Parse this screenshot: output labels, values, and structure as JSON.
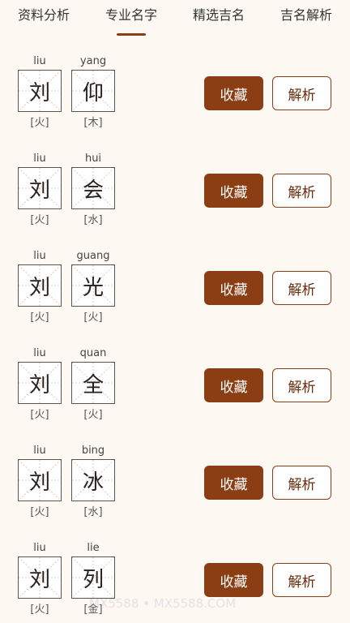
{
  "tabs": [
    {
      "label": "资料分析",
      "active": false
    },
    {
      "label": "专业名字",
      "active": true
    },
    {
      "label": "精选吉名",
      "active": false
    },
    {
      "label": "吉名解析",
      "active": false
    }
  ],
  "buttons": {
    "favorite": "收藏",
    "parse": "解析"
  },
  "names": [
    {
      "c1": {
        "pinyin": "liu",
        "char": "刘",
        "element": "[火]"
      },
      "c2": {
        "pinyin": "yang",
        "char": "仰",
        "element": "[木]"
      }
    },
    {
      "c1": {
        "pinyin": "liu",
        "char": "刘",
        "element": "[火]"
      },
      "c2": {
        "pinyin": "hui",
        "char": "会",
        "element": "[水]"
      }
    },
    {
      "c1": {
        "pinyin": "liu",
        "char": "刘",
        "element": "[火]"
      },
      "c2": {
        "pinyin": "guang",
        "char": "光",
        "element": "[火]"
      }
    },
    {
      "c1": {
        "pinyin": "liu",
        "char": "刘",
        "element": "[火]"
      },
      "c2": {
        "pinyin": "quan",
        "char": "全",
        "element": "[火]"
      }
    },
    {
      "c1": {
        "pinyin": "liu",
        "char": "刘",
        "element": "[火]"
      },
      "c2": {
        "pinyin": "bing",
        "char": "冰",
        "element": "[水]"
      }
    },
    {
      "c1": {
        "pinyin": "liu",
        "char": "刘",
        "element": "[火]"
      },
      "c2": {
        "pinyin": "lie",
        "char": "列",
        "element": "[金]"
      }
    }
  ],
  "watermark": "MX5588 • MX5588.COM",
  "colors": {
    "accent": "#8b3e14",
    "background": "#fdf9f2"
  }
}
